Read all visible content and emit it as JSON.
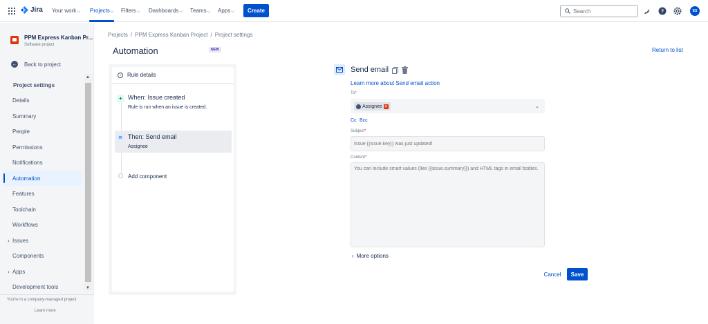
{
  "topnav": {
    "logo": "Jira",
    "items": [
      {
        "label": "Your work",
        "chevron": true
      },
      {
        "label": "Projects",
        "chevron": true,
        "active": true
      },
      {
        "label": "Filters",
        "chevron": true
      },
      {
        "label": "Dashboards",
        "chevron": true
      },
      {
        "label": "Teams",
        "chevron": true
      },
      {
        "label": "Apps",
        "chevron": true
      }
    ],
    "create_label": "Create",
    "search_placeholder": "Search",
    "avatar_initials": "ES",
    "icons": [
      "app-switcher-icon",
      "notifications-icon",
      "help-icon",
      "settings-icon"
    ]
  },
  "sidebar": {
    "project_name": "PPM Express Kanban Pr...",
    "project_type": "Software project",
    "back_label": "Back to project",
    "heading": "Project settings",
    "items": [
      {
        "label": "Details"
      },
      {
        "label": "Summary"
      },
      {
        "label": "People"
      },
      {
        "label": "Permissions"
      },
      {
        "label": "Notifications"
      },
      {
        "label": "Automation",
        "active": true
      },
      {
        "label": "Features"
      },
      {
        "label": "Toolchain"
      },
      {
        "label": "Workflows"
      },
      {
        "label": "Issues",
        "caret": true
      },
      {
        "label": "Components"
      },
      {
        "label": "Apps",
        "caret": true
      },
      {
        "label": "Development tools"
      }
    ],
    "footer_text": "You're in a company-managed project",
    "footer_link": "Learn more"
  },
  "main": {
    "breadcrumb": [
      "Projects",
      "PPM Express Kanban Project",
      "Project settings"
    ],
    "title": "Automation",
    "badge": "NEW",
    "return_link": "Return to list"
  },
  "rule": {
    "details_label": "Rule details",
    "trigger_title": "When: Issue created",
    "trigger_desc": "Rule is run when an issue is created.",
    "action_title": "Then: Send email",
    "action_desc": "Assignee",
    "add_label": "Add component"
  },
  "form": {
    "title": "Send email",
    "learn_link": "Learn more about Send email action",
    "to_label": "To",
    "to_chip": "Assignee",
    "cc_label": "Cc",
    "bcc_label": "Bcc",
    "subject_label": "Subject",
    "subject_placeholder": "Issue {{issue.key}} was just updated!",
    "content_label": "Content",
    "content_placeholder": "You can include smart values (like {{issue.summary}}) and HTML tags in email bodies.",
    "more_options": "More options",
    "cancel_label": "Cancel",
    "save_label": "Save"
  },
  "colors": {
    "brand": "#0052cc",
    "trigger_green": "#00875a",
    "remove_red": "#de350b"
  }
}
